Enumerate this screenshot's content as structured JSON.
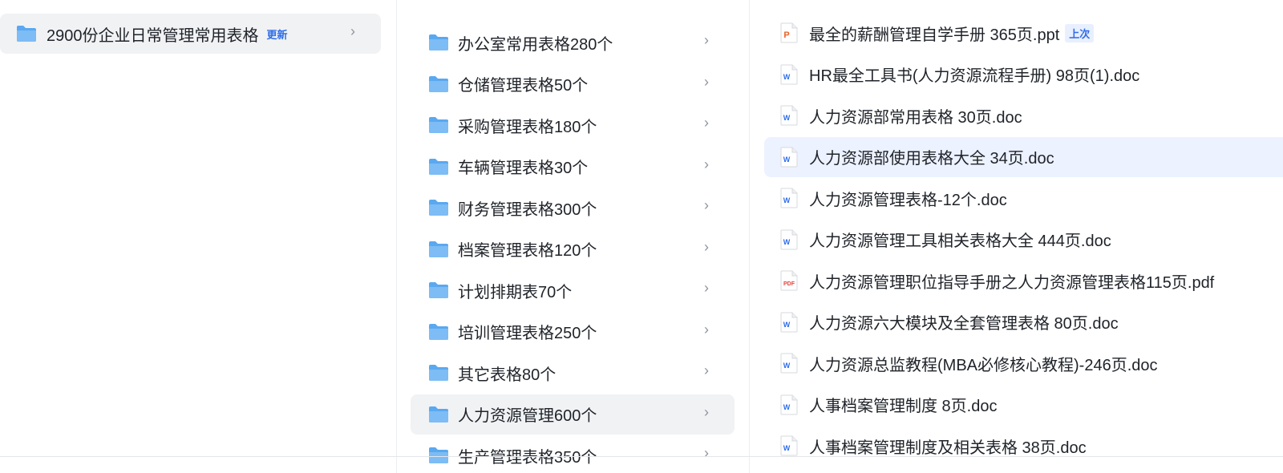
{
  "root_folder": {
    "label": "2900份企业日常管理常用表格",
    "badge": "更新",
    "chevron": "›"
  },
  "categories": [
    {
      "label": "办公室常用表格280个",
      "chevron": "›"
    },
    {
      "label": "仓储管理表格50个",
      "chevron": "›"
    },
    {
      "label": "采购管理表格180个",
      "chevron": "›"
    },
    {
      "label": "车辆管理表格30个",
      "chevron": "›"
    },
    {
      "label": "财务管理表格300个",
      "chevron": "›"
    },
    {
      "label": "档案管理表格120个",
      "chevron": "›"
    },
    {
      "label": "计划排期表70个",
      "chevron": "›"
    },
    {
      "label": "培训管理表格250个",
      "chevron": "›"
    },
    {
      "label": "其它表格80个",
      "chevron": "›"
    },
    {
      "label": "人力资源管理600个",
      "chevron": "›"
    },
    {
      "label": "生产管理表格350个",
      "chevron": "›"
    }
  ],
  "files": [
    {
      "name": "最全的薪酬管理自学手册 365页.ppt",
      "type": "ppt",
      "icon_text": "P",
      "badge": "上次"
    },
    {
      "name": "HR最全工具书(人力资源流程手册) 98页(1).doc",
      "type": "doc",
      "icon_text": "W"
    },
    {
      "name": "人力资源部常用表格 30页.doc",
      "type": "doc",
      "icon_text": "W"
    },
    {
      "name": "人力资源部使用表格大全 34页.doc",
      "type": "doc",
      "icon_text": "W"
    },
    {
      "name": "人力资源管理表格-12个.doc",
      "type": "doc",
      "icon_text": "W"
    },
    {
      "name": "人力资源管理工具相关表格大全 444页.doc",
      "type": "doc",
      "icon_text": "W"
    },
    {
      "name": "人力资源管理职位指导手册之人力资源管理表格115页.pdf",
      "type": "pdf",
      "icon_text": "PDF"
    },
    {
      "name": "人力资源六大模块及全套管理表格 80页.doc",
      "type": "doc",
      "icon_text": "W"
    },
    {
      "name": "人力资源总监教程(MBA必修核心教程)-246页.doc",
      "type": "doc",
      "icon_text": "W"
    },
    {
      "name": "人事档案管理制度 8页.doc",
      "type": "doc",
      "icon_text": "W"
    },
    {
      "name": "人事档案管理制度及相关表格 38页.doc",
      "type": "doc",
      "icon_text": "W"
    }
  ],
  "colors": {
    "folder": "#5aa8f0",
    "doc_icon": "#2f6de8",
    "ppt_icon": "#e8632b",
    "pdf_icon": "#e8403a",
    "accent": "#2f6de8",
    "selected_grey": "#f1f2f4",
    "selected_blue": "#ecf2ff"
  }
}
